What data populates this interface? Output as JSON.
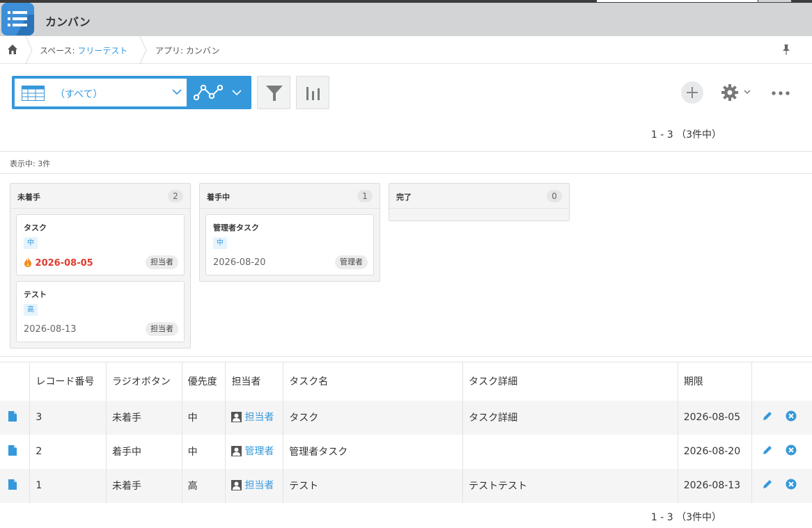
{
  "app": {
    "title": "カンバン",
    "icon": "app-list-icon"
  },
  "breadcrumb": {
    "home_icon": "home-icon",
    "space_prefix": "スペース: ",
    "space_name": "フリーテスト",
    "app_label": "アプリ: カンバン",
    "pin_icon": "pin-icon"
  },
  "toolbar": {
    "view_name": "（すべて）",
    "pagination_top": "1 - 3 （3件中）",
    "pagination_bottom": "1 - 3 （3件中）"
  },
  "kanban": {
    "status_text": "表示中: 3件",
    "columns": [
      {
        "title": "未着手",
        "count": "2",
        "cards": [
          {
            "title": "タスク",
            "priority": "中",
            "date": "2026-08-05",
            "overdue": true,
            "assignee": "担当者"
          },
          {
            "title": "テスト",
            "priority": "高",
            "date": "2026-08-13",
            "overdue": false,
            "assignee": "担当者"
          }
        ]
      },
      {
        "title": "着手中",
        "count": "1",
        "cards": [
          {
            "title": "管理者タスク",
            "priority": "中",
            "date": "2026-08-20",
            "overdue": false,
            "assignee": "管理者"
          }
        ]
      },
      {
        "title": "完了",
        "count": "0",
        "cards": []
      }
    ]
  },
  "table": {
    "headers": [
      "レコード番号",
      "ラジオボタン",
      "優先度",
      "担当者",
      "タスク名",
      "タスク詳細",
      "期限"
    ],
    "rows": [
      {
        "record": "3",
        "radio": "未着手",
        "priority": "中",
        "assignee": "担当者",
        "task": "タスク",
        "detail": "タスク詳細",
        "due": "2026-08-05"
      },
      {
        "record": "2",
        "radio": "着手中",
        "priority": "中",
        "assignee": "管理者",
        "task": "管理者タスク",
        "detail": "",
        "due": "2026-08-20"
      },
      {
        "record": "1",
        "radio": "未着手",
        "priority": "高",
        "assignee": "担当者",
        "task": "テスト",
        "detail": "テストテスト",
        "due": "2026-08-13"
      }
    ]
  },
  "colors": {
    "accent": "#3498db",
    "overdue": "#e03b30",
    "header_bg": "#d2d4d6"
  }
}
